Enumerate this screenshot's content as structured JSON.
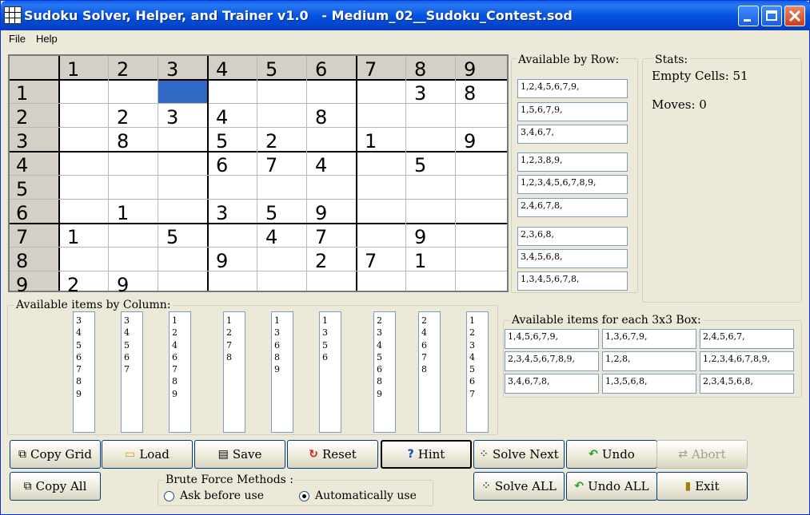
{
  "window": {
    "title": "Sudoku Solver, Helper, and Trainer v1.0   - Medium_02__Sudoku_Contest.sod",
    "minimize_icon": "minimize-icon",
    "maximize_icon": "maximize-icon",
    "close_icon": "close-icon"
  },
  "menu": {
    "file": "File",
    "help": "Help"
  },
  "grid": {
    "col_headers": [
      "1",
      "2",
      "3",
      "4",
      "5",
      "6",
      "7",
      "8",
      "9"
    ],
    "row_headers": [
      "1",
      "2",
      "3",
      "4",
      "5",
      "6",
      "7",
      "8",
      "9"
    ],
    "selected_cell": {
      "row": 1,
      "col": 3
    },
    "cells": [
      [
        "",
        "",
        "",
        "",
        "",
        "",
        "",
        "3",
        "8"
      ],
      [
        "",
        "2",
        "3",
        "4",
        "",
        "8",
        "",
        "",
        ""
      ],
      [
        "",
        "8",
        "",
        "5",
        "2",
        "",
        "1",
        "",
        "9"
      ],
      [
        "",
        "",
        "",
        "6",
        "7",
        "4",
        "",
        "5",
        ""
      ],
      [
        "",
        "",
        "",
        "",
        "",
        "",
        "",
        "",
        ""
      ],
      [
        "",
        "1",
        "",
        "3",
        "5",
        "9",
        "",
        "",
        ""
      ],
      [
        "1",
        "",
        "5",
        "",
        "4",
        "7",
        "",
        "9",
        ""
      ],
      [
        "",
        "",
        "",
        "9",
        "",
        "2",
        "7",
        "1",
        ""
      ],
      [
        "2",
        "9",
        "",
        "",
        "",
        "",
        "",
        "",
        ""
      ]
    ]
  },
  "available_by_row": {
    "label": "Available by Row:",
    "rows": [
      "1,2,4,5,6,7,9,",
      "1,5,6,7,9,",
      "3,4,6,7,",
      "1,2,3,8,9,",
      "1,2,3,4,5,6,7,8,9,",
      "2,4,6,7,8,",
      "2,3,6,8,",
      "3,4,5,6,8,",
      "1,3,4,5,6,7,8,"
    ]
  },
  "stats": {
    "label": "Stats:",
    "empty_cells": "Empty Cells: 51",
    "moves": "Moves: 0"
  },
  "available_by_column": {
    "label": "Available items by Column:",
    "columns": [
      [
        "3",
        "4",
        "5",
        "6",
        "7",
        "8",
        "9"
      ],
      [
        "3",
        "4",
        "5",
        "6",
        "7"
      ],
      [
        "1",
        "2",
        "4",
        "6",
        "7",
        "8",
        "9"
      ],
      [
        "1",
        "2",
        "7",
        "8"
      ],
      [
        "1",
        "3",
        "6",
        "8",
        "9"
      ],
      [
        "1",
        "3",
        "5",
        "6"
      ],
      [
        "2",
        "3",
        "4",
        "5",
        "6",
        "8",
        "9"
      ],
      [
        "2",
        "4",
        "6",
        "7",
        "8"
      ],
      [
        "1",
        "2",
        "3",
        "4",
        "5",
        "6",
        "7"
      ]
    ]
  },
  "available_by_box": {
    "label": "Available items for each 3x3 Box:",
    "boxes": [
      "1,4,5,6,7,9,",
      "1,3,6,7,9,",
      "2,4,5,6,7,",
      "2,3,4,5,6,7,8,9,",
      "1,2,8,",
      "1,2,3,4,6,7,8,9,",
      "3,4,6,7,8,",
      "1,3,5,6,8,",
      "2,3,4,5,6,8,"
    ]
  },
  "buttons": {
    "copy_grid": "Copy Grid",
    "load": "Load",
    "save": "Save",
    "reset": "Reset",
    "hint": "Hint",
    "solve_next": "Solve Next",
    "undo": "Undo",
    "abort": "Abort",
    "copy_all": "Copy All",
    "solve_all": "Solve ALL",
    "undo_all": "Undo ALL",
    "exit": "Exit"
  },
  "brute_force": {
    "label": "Brute Force Methods :",
    "ask": "Ask before use",
    "auto": "Automatically use",
    "selected": "auto"
  },
  "colors": {
    "selection": "#316ac5",
    "titlebar": "#0554e0",
    "background": "#ece9d8"
  }
}
